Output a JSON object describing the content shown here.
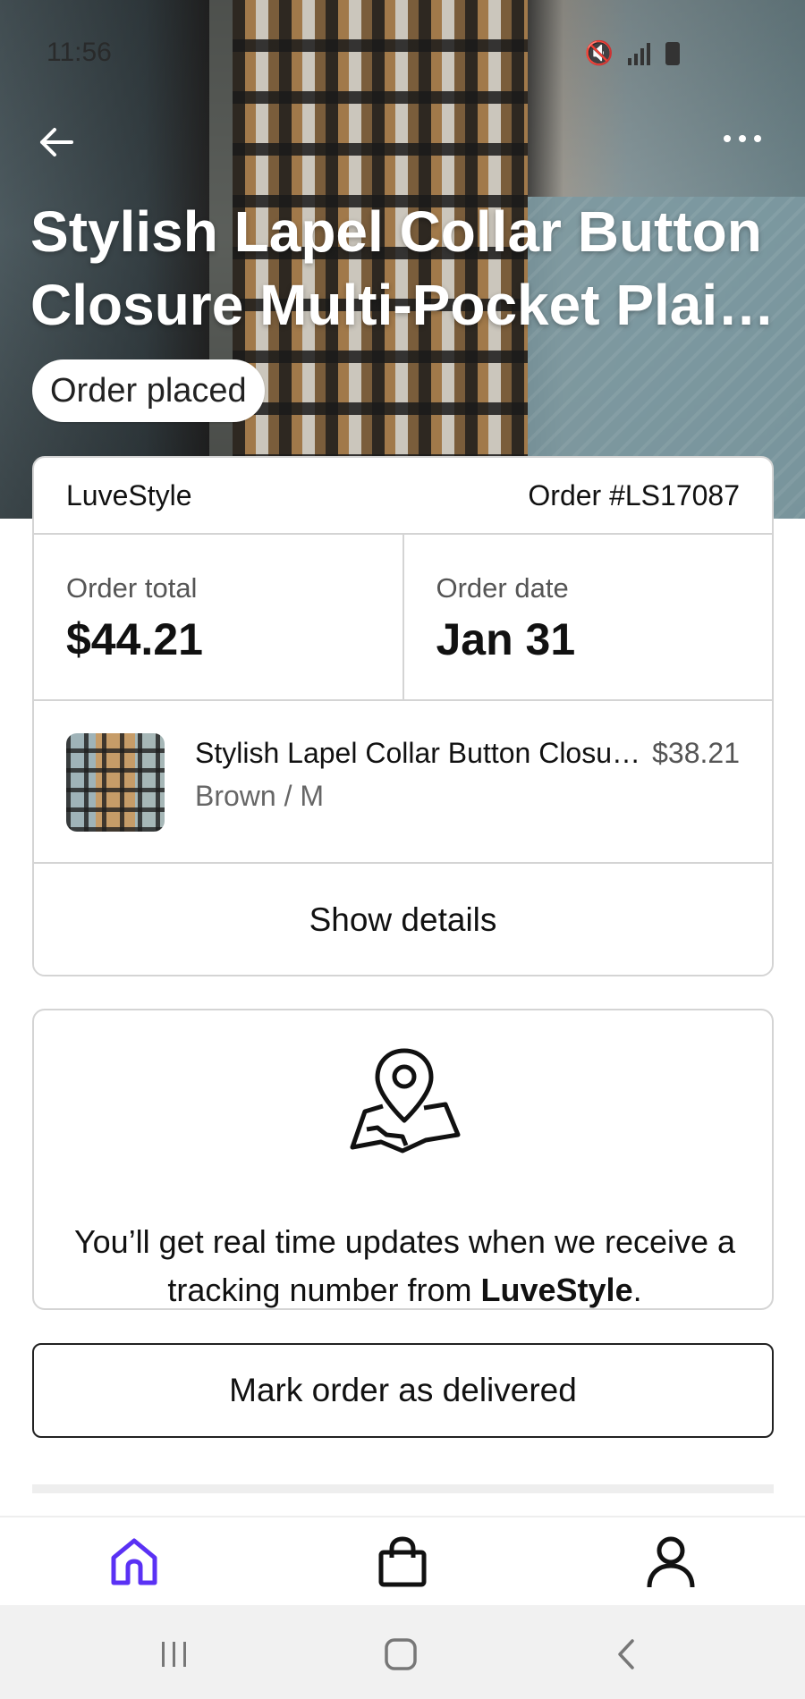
{
  "status_bar": {
    "time": "11:56"
  },
  "hero": {
    "title": "Stylish Lapel Collar Button Closure Multi-Pocket Plaid Shirt Coat",
    "status_label": "Order placed"
  },
  "order": {
    "store": "LuveStyle",
    "number": "Order #LS17087",
    "total_label": "Order total",
    "total_value": "$44.21",
    "date_label": "Order date",
    "date_value": "Jan 31",
    "item": {
      "name": "Stylish Lapel Collar Button Closure Multi-Pocket Plaid Shirt Coat",
      "price": "$38.21",
      "variant": "Brown / M"
    },
    "show_details_label": "Show details"
  },
  "tracking": {
    "message_prefix": "You’ll get real time updates when we receive a tracking number from ",
    "store": "LuveStyle",
    "suffix": "."
  },
  "actions": {
    "mark_delivered_label": "Mark order as delivered"
  },
  "bottom_nav": {
    "items": [
      {
        "name": "home",
        "icon": "home-icon",
        "active": true
      },
      {
        "name": "shop",
        "icon": "shopping-bag-icon",
        "active": false
      },
      {
        "name": "profile",
        "icon": "user-icon",
        "active": false
      }
    ],
    "active_color": "#5a31f4"
  }
}
